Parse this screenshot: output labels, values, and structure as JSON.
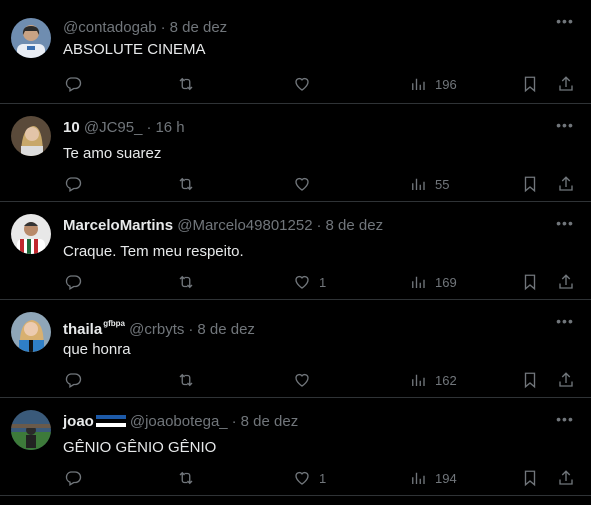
{
  "tweets": [
    {
      "name": "",
      "handle": "@contadogab",
      "time": "8 de dez",
      "text": "ABSOLUTE CINEMA",
      "likes": "",
      "views": "196",
      "avatar": "avatar-man-white-jersey"
    },
    {
      "name": "10",
      "handle": "@JC95_",
      "time": "16 h",
      "text": "Te amo suarez",
      "likes": "",
      "views": "55",
      "avatar": "avatar-woman-blonde"
    },
    {
      "name": "MarceloMartins",
      "handle": "@Marcelo49801252",
      "time": "8 de dez",
      "text": "Craque. Tem meu respeito.",
      "likes": "1",
      "views": "169",
      "avatar": "avatar-man-striped-jersey"
    },
    {
      "name": "thaila",
      "badge": "gfbpa",
      "handle": "@crbyts",
      "time": "8 de dez",
      "text": "que honra",
      "likes": "",
      "views": "162",
      "avatar": "avatar-woman-blue-jersey"
    },
    {
      "name": "joao",
      "flag": "gremio-flag",
      "handle": "@joaobotega_",
      "time": "8 de dez",
      "text": "GÊNIO GÊNIO GÊNIO",
      "likes": "1",
      "views": "194",
      "avatar": "avatar-man-stadium"
    }
  ],
  "icons": {
    "reply": "reply-icon",
    "retweet": "retweet-icon",
    "like": "heart-icon",
    "views": "views-icon",
    "bookmark": "bookmark-icon",
    "share": "share-icon",
    "more": "more-icon"
  },
  "colors": {
    "background": "#000000",
    "text": "#e7e9ea",
    "muted": "#71767b",
    "divider": "#2f3336"
  }
}
